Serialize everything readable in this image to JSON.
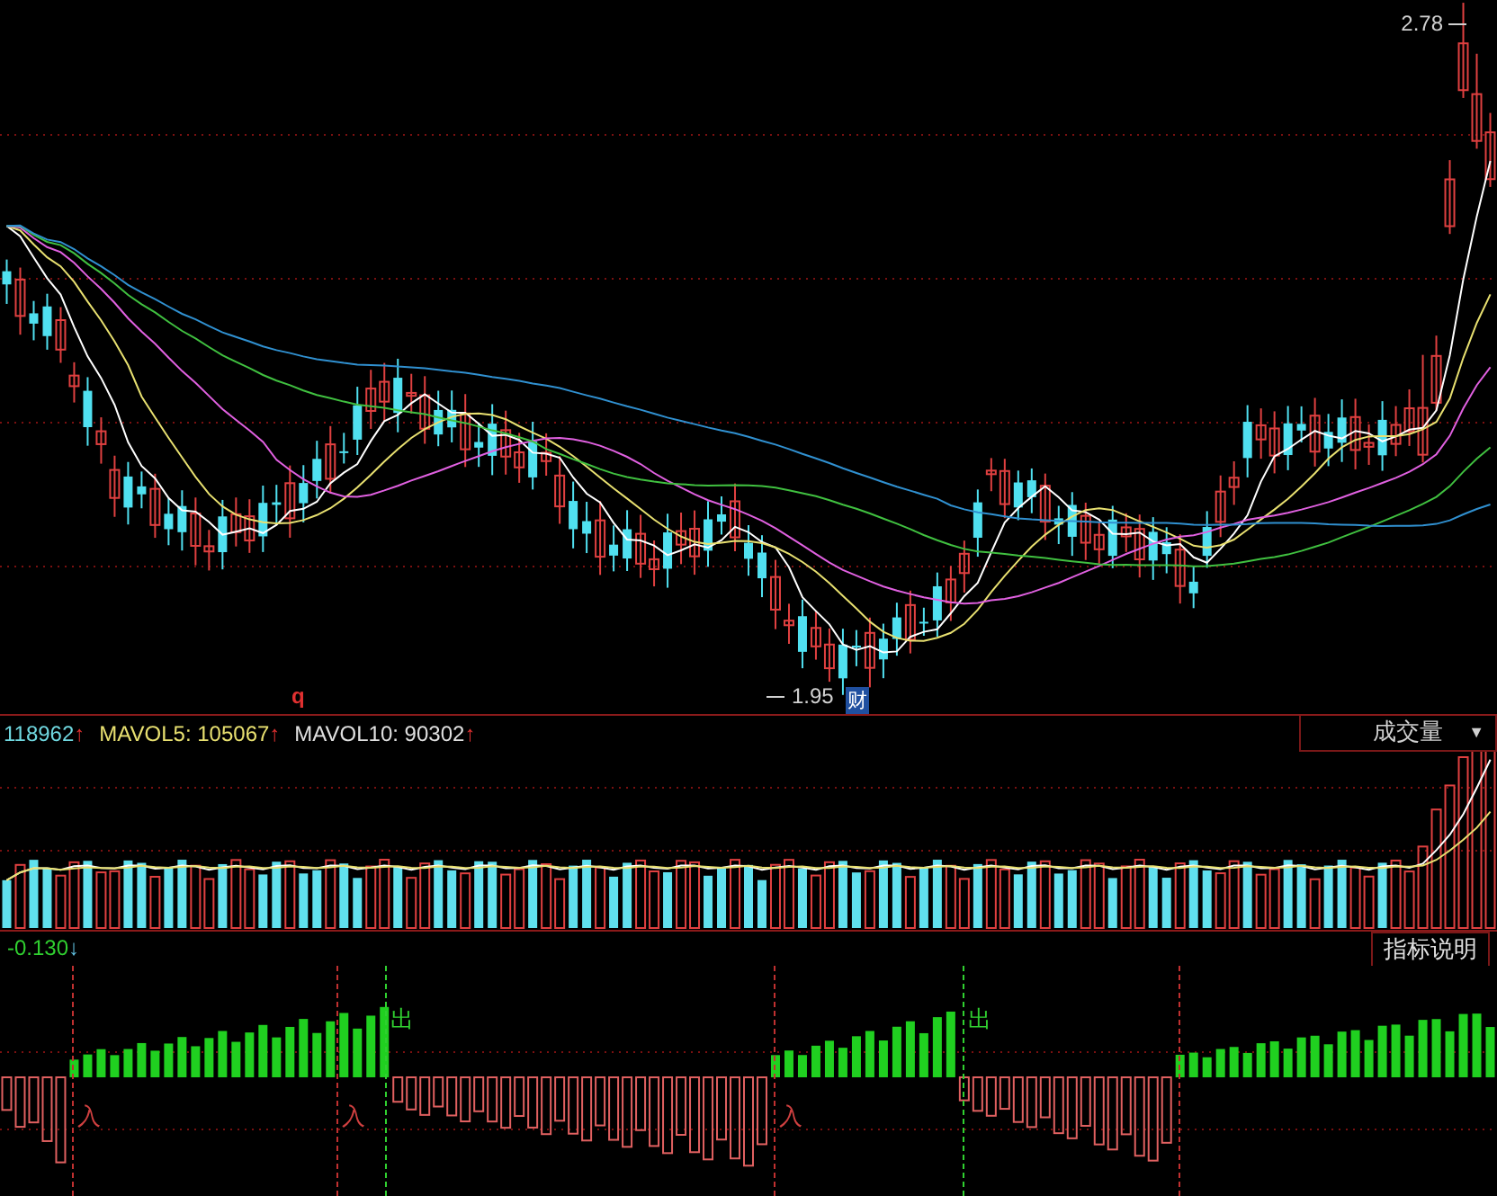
{
  "price_panel": {
    "high_label": "2.78",
    "low_label": "1.95",
    "marker": "q",
    "event_badge": "财"
  },
  "volume_panel": {
    "legend": [
      {
        "text": "118962",
        "arrow": "↑",
        "color": "#70d8e0"
      },
      {
        "text": "MAVOL5: 105067",
        "arrow": "↑",
        "color": "#e8e070"
      },
      {
        "text": "MAVOL10: 90302",
        "arrow": "↑",
        "color": "#e0e0e0"
      }
    ],
    "selector": {
      "label": "成交量",
      "caret": "▼"
    }
  },
  "indicator_panel": {
    "reading": "-0.130",
    "arrow": "↓",
    "help_button": "指标说明",
    "signals": [
      {
        "kind": "buy",
        "label": "入"
      },
      {
        "kind": "buy",
        "label": "入"
      },
      {
        "kind": "sell",
        "label": "出"
      },
      {
        "kind": "buy",
        "label": "入"
      },
      {
        "kind": "sell",
        "label": "出"
      },
      {
        "kind": "buy"
      }
    ]
  }
}
